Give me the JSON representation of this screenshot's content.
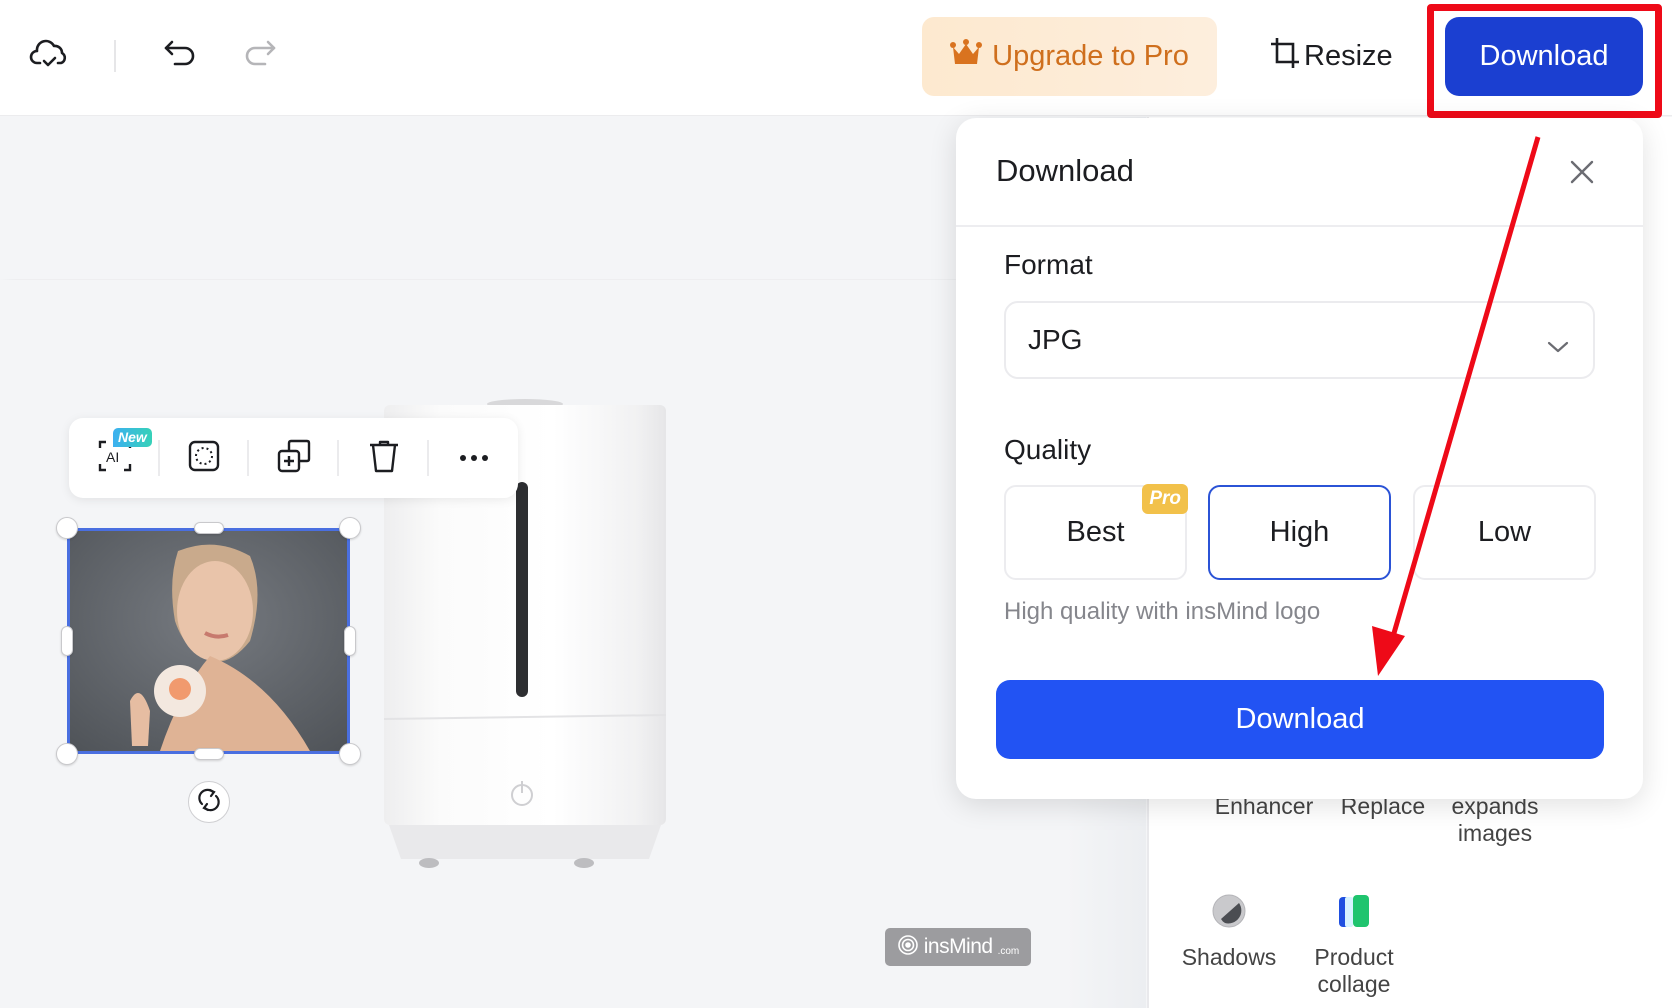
{
  "topbar": {
    "cloud_icon": "cloud-check-icon",
    "undo_icon": "undo-icon",
    "redo_icon": "redo-icon",
    "upgrade_label": "Upgrade to Pro",
    "upgrade_icon": "crown-icon",
    "resize_label": "Resize",
    "resize_icon": "crop-icon",
    "download_label": "Download"
  },
  "context_toolbar": {
    "items": [
      {
        "icon": "ai-scan-icon",
        "label": "AI",
        "badge": "New"
      },
      {
        "icon": "select-region-icon"
      },
      {
        "icon": "duplicate-icon"
      },
      {
        "icon": "trash-icon"
      },
      {
        "icon": "more-icon"
      }
    ]
  },
  "canvas": {
    "selected_element": "photo",
    "rotate_icon": "rotate-icon",
    "watermark_text": "insMind",
    "watermark_domain": ".com"
  },
  "sidebar": {
    "tools_row1": [
      "Enhancer",
      "Replace",
      "expands images"
    ],
    "tools_row2": [
      {
        "label": "Shadows",
        "icon": "shadows-icon"
      },
      {
        "label": "Product collage",
        "icon": "product-collage-icon"
      }
    ]
  },
  "download_panel": {
    "title": "Download",
    "close_icon": "close-icon",
    "format_label": "Format",
    "format_value": "JPG",
    "quality_label": "Quality",
    "quality_options": [
      {
        "label": "Best",
        "badge": "Pro",
        "selected": false
      },
      {
        "label": "High",
        "selected": true
      },
      {
        "label": "Low",
        "selected": false
      }
    ],
    "quality_hint": "High quality with insMind logo",
    "download_button": "Download"
  },
  "annotation": {
    "highlight_color": "#ee0a18",
    "arrow_color": "#ee0a18"
  },
  "colors": {
    "primary": "#2253f3",
    "primary_dark": "#1b3fd1",
    "upgrade_text": "#cf6f1d",
    "pro_badge": "#f2c14a",
    "selection": "#4a6fe0"
  }
}
